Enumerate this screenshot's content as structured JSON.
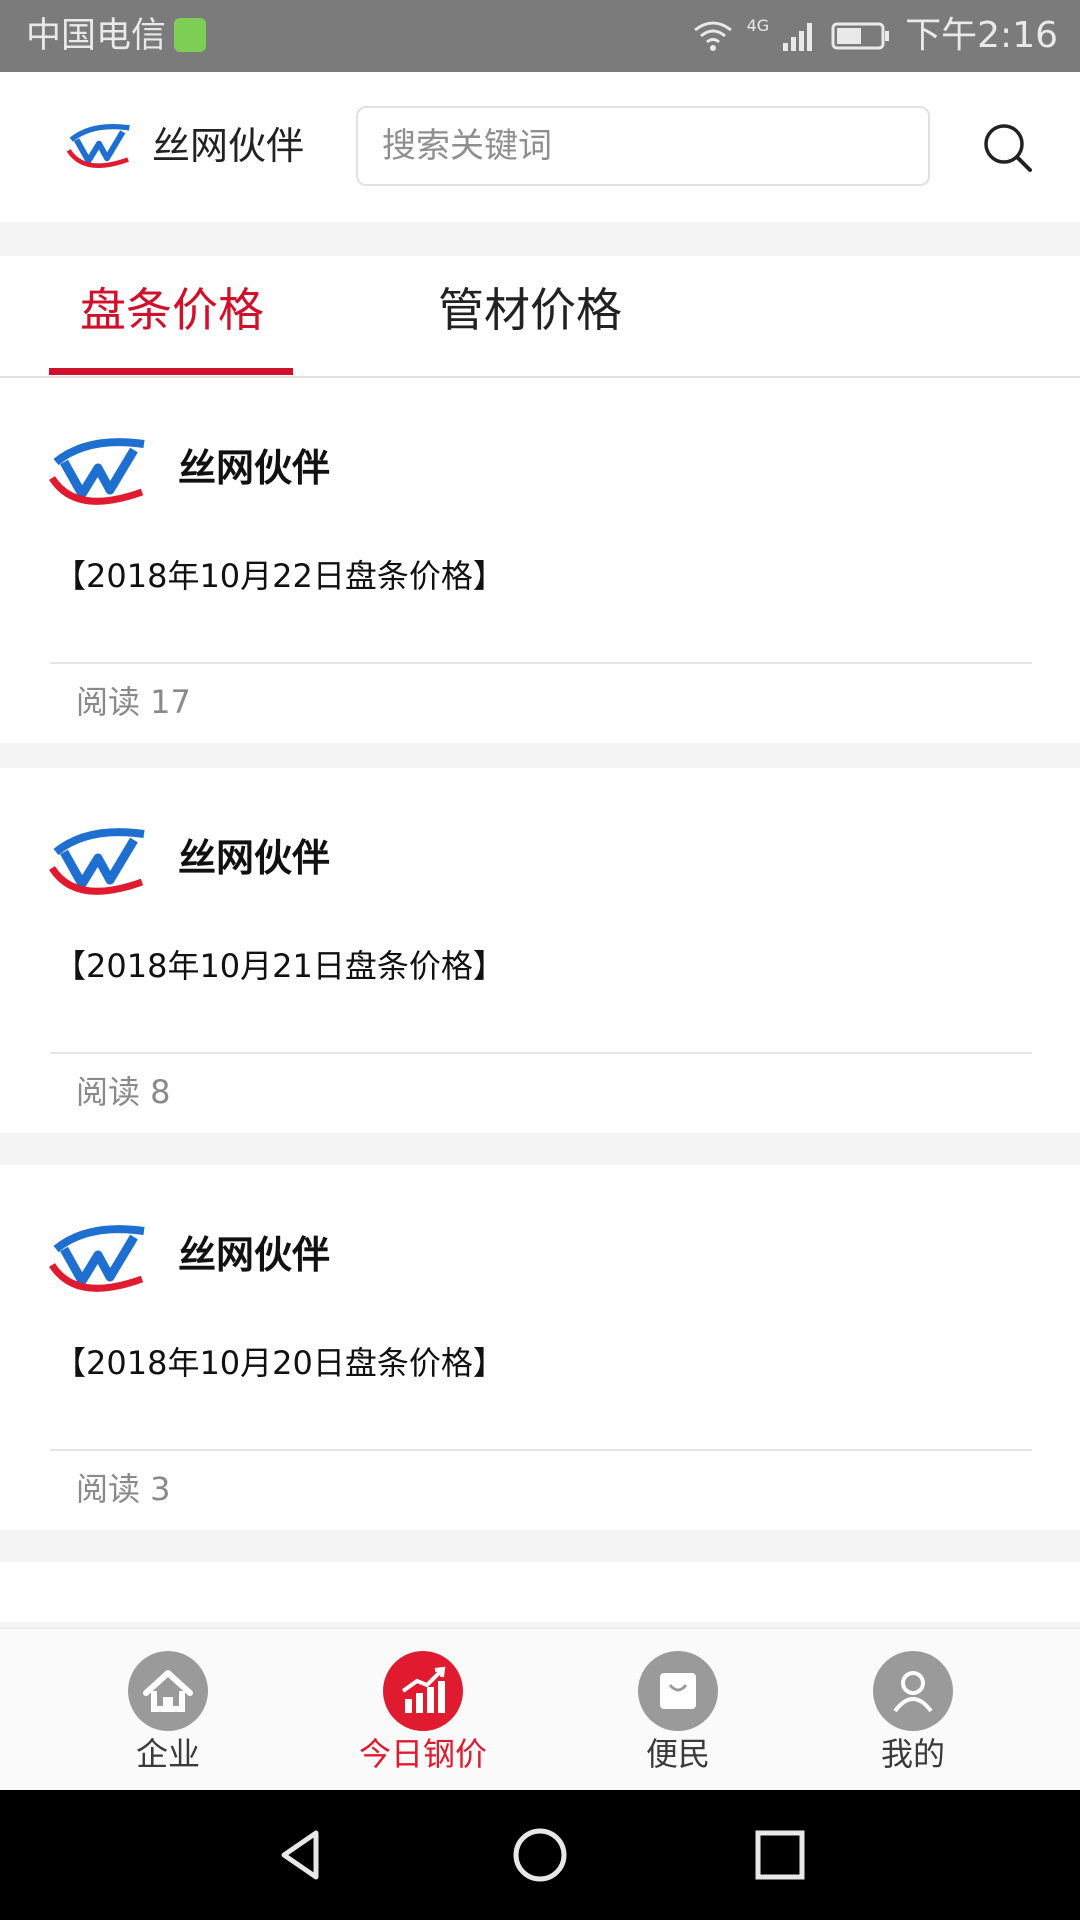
{
  "status_bar": {
    "carrier": "中国电信",
    "network": "4G",
    "time": "下午2:16"
  },
  "header": {
    "brand_name": "丝网伙伴",
    "search_placeholder": "搜索关键词"
  },
  "tabs": [
    {
      "label": "盘条价格",
      "active": true
    },
    {
      "label": "管材价格",
      "active": false
    }
  ],
  "articles": [
    {
      "source": "丝网伙伴",
      "title": "【2018年10月22日盘条价格】",
      "reads": "阅读 17"
    },
    {
      "source": "丝网伙伴",
      "title": "【2018年10月21日盘条价格】",
      "reads": "阅读 8"
    },
    {
      "source": "丝网伙伴",
      "title": "【2018年10月20日盘条价格】",
      "reads": "阅读 3"
    }
  ],
  "bottom_nav": [
    {
      "label": "企业",
      "icon": "home-icon",
      "active": false
    },
    {
      "label": "今日钢价",
      "icon": "chart-icon",
      "active": true
    },
    {
      "label": "便民",
      "icon": "bag-icon",
      "active": false
    },
    {
      "label": "我的",
      "icon": "user-icon",
      "active": false
    }
  ],
  "colors": {
    "accent": "#d0112b",
    "status_bar": "#7b7b7b",
    "inactive_icon": "#9a9a9a"
  }
}
